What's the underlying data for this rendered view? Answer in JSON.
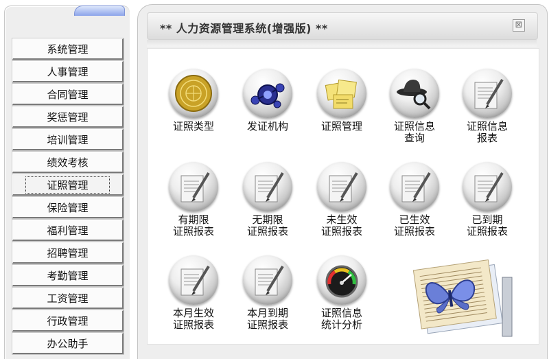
{
  "window": {
    "title": "** 人力资源管理系统(增强版) **",
    "close_symbol": "⊠"
  },
  "sidebar": {
    "items": [
      {
        "label": "系统管理"
      },
      {
        "label": "人事管理"
      },
      {
        "label": "合同管理"
      },
      {
        "label": "奖惩管理"
      },
      {
        "label": "培训管理"
      },
      {
        "label": "绩效考核"
      },
      {
        "label": "证照管理",
        "active": true
      },
      {
        "label": "保险管理"
      },
      {
        "label": "福利管理"
      },
      {
        "label": "招聘管理"
      },
      {
        "label": "考勤管理"
      },
      {
        "label": "工资管理"
      },
      {
        "label": "行政管理"
      },
      {
        "label": "办公助手"
      }
    ]
  },
  "modules": [
    {
      "line1": "证照类型",
      "line2": "",
      "icon": "passport-seal-icon"
    },
    {
      "line1": "发证机构",
      "line2": "",
      "icon": "network-hub-icon"
    },
    {
      "line1": "证照管理",
      "line2": "",
      "icon": "sticky-notes-icon"
    },
    {
      "line1": "证照信息",
      "line2": "查询",
      "icon": "magnifier-hat-icon"
    },
    {
      "line1": "证照信息",
      "line2": "报表",
      "icon": "report-pen-icon"
    },
    {
      "line1": "有期限",
      "line2": "证照报表",
      "icon": "report-pen-icon"
    },
    {
      "line1": "无期限",
      "line2": "证照报表",
      "icon": "report-pen-icon"
    },
    {
      "line1": "未生效",
      "line2": "证照报表",
      "icon": "report-pen-icon"
    },
    {
      "line1": "已生效",
      "line2": "证照报表",
      "icon": "report-pen-icon"
    },
    {
      "line1": "已到期",
      "line2": "证照报表",
      "icon": "report-pen-icon"
    },
    {
      "line1": "本月生效",
      "line2": "证照报表",
      "icon": "report-pen-icon"
    },
    {
      "line1": "本月到期",
      "line2": "证照报表",
      "icon": "report-pen-icon"
    },
    {
      "line1": "证照信息",
      "line2": "统计分析",
      "icon": "gauge-icon"
    }
  ],
  "decor": {
    "icon": "butterfly-documents-illustration"
  }
}
